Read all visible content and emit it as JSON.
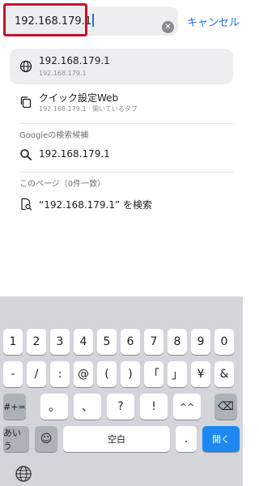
{
  "address_bar": {
    "text": "192.168.179.1",
    "clear_glyph": "✕"
  },
  "cancel_label": "キャンセル",
  "suggestions": [
    {
      "title": "192.168.179.1",
      "subtitle": "192.168.179.1",
      "icon": "globe-icon"
    },
    {
      "title": "クイック設定Web",
      "subtitle": "192.168.179.1 · 開いているタブ",
      "icon": "tabs-icon"
    }
  ],
  "google_section": {
    "label": "Googleの検索候補",
    "query": "192.168.179.1",
    "icon": "search-icon"
  },
  "page_section": {
    "label": "このページ（0件一致）",
    "find_text": "“192.168.179.1” を検索",
    "icon": "find-in-page-icon"
  },
  "keyboard": {
    "row1": [
      "1",
      "2",
      "3",
      "4",
      "5",
      "6",
      "7",
      "8",
      "9",
      "0"
    ],
    "row2": [
      "-",
      "/",
      ":",
      "@",
      "(",
      ")",
      "「",
      "」",
      "¥",
      "&"
    ],
    "row3_left": "#+=",
    "row3_mid": [
      "。",
      "、",
      "?",
      "!",
      "^^"
    ],
    "row3_backspace_glyph": "⌫",
    "row4": {
      "kana": "あいう",
      "space": "空白",
      "dot": ".",
      "enter": "開く"
    },
    "emoji_glyph": "☺"
  },
  "colors": {
    "accent": "#1a73e8",
    "highlight": "#c8102e",
    "enter_key": "#1e88f0"
  }
}
